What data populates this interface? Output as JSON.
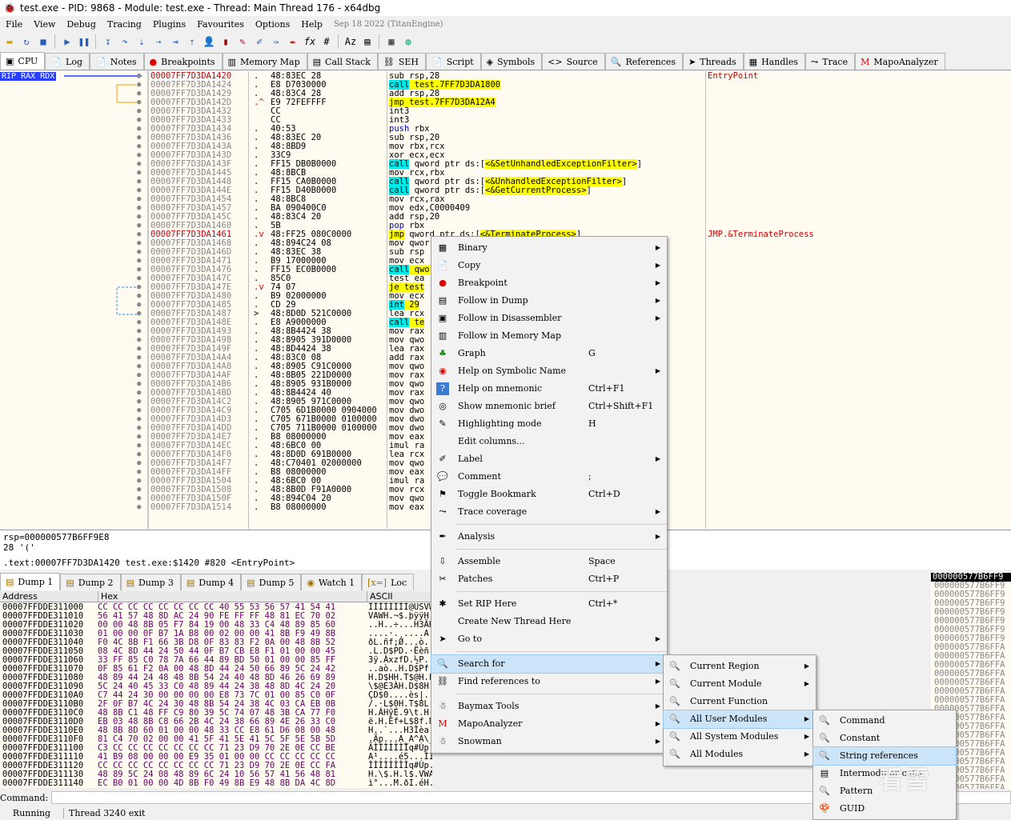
{
  "window": {
    "title": "test.exe - PID: 9868 - Module: test.exe - Thread: Main Thread 176 - x64dbg"
  },
  "menu": {
    "items": [
      "File",
      "View",
      "Debug",
      "Tracing",
      "Plugins",
      "Favourites",
      "Options",
      "Help"
    ],
    "info": "Sep 18 2022 (TitanEngine)"
  },
  "tabs": [
    "CPU",
    "Log",
    "Notes",
    "Breakpoints",
    "Memory Map",
    "Call Stack",
    "SEH",
    "Script",
    "Symbols",
    "Source",
    "References",
    "Threads",
    "Handles",
    "Trace",
    "MapoAnalyzer"
  ],
  "register_tag": "RIP RAX RDX",
  "disasm": [
    {
      "addr": "00007FF7D3DA1420",
      "m": ".",
      "bytes": "48:83EC 28",
      "instr": "sub rsp,28",
      "cmt": "EntryPoint",
      "cur": true
    },
    {
      "addr": "00007FF7D3DA1424",
      "m": ".",
      "bytes": "E8 D7030000",
      "instr": "call test.7FF7D3DA1800",
      "k": "call"
    },
    {
      "addr": "00007FF7D3DA1429",
      "m": ".",
      "bytes": "48:83C4 28",
      "instr": "add rsp,28"
    },
    {
      "addr": "00007FF7D3DA142D",
      "m": ".^",
      "bytes": "E9 72FEFFFF",
      "instr": "jmp test.7FF7D3DA12A4",
      "k": "jmp"
    },
    {
      "addr": "00007FF7D3DA1432",
      "m": "",
      "bytes": "CC",
      "instr": "int3"
    },
    {
      "addr": "00007FF7D3DA1433",
      "m": "",
      "bytes": "CC",
      "instr": "int3"
    },
    {
      "addr": "00007FF7D3DA1434",
      "m": ".",
      "bytes": "40:53",
      "instr": "push rbx"
    },
    {
      "addr": "00007FF7D3DA1436",
      "m": ".",
      "bytes": "48:83EC 20",
      "instr": "sub rsp,20"
    },
    {
      "addr": "00007FF7D3DA143A",
      "m": ".",
      "bytes": "48:8BD9",
      "instr": "mov rbx,rcx"
    },
    {
      "addr": "00007FF7D3DA143D",
      "m": ".",
      "bytes": "33C9",
      "instr": "xor ecx,ecx"
    },
    {
      "addr": "00007FF7D3DA143F",
      "m": ".",
      "bytes": "FF15 DB0B0000",
      "instr": "call qword ptr ds:[<&SetUnhandledExceptionFilter>]",
      "k": "call"
    },
    {
      "addr": "00007FF7D3DA1445",
      "m": ".",
      "bytes": "48:8BCB",
      "instr": "mov rcx,rbx"
    },
    {
      "addr": "00007FF7D3DA1448",
      "m": ".",
      "bytes": "FF15 CA0B0000",
      "instr": "call qword ptr ds:[<&UnhandledExceptionFilter>]",
      "k": "call"
    },
    {
      "addr": "00007FF7D3DA144E",
      "m": ".",
      "bytes": "FF15 D40B0000",
      "instr": "call qword ptr ds:[<&GetCurrentProcess>]",
      "k": "call"
    },
    {
      "addr": "00007FF7D3DA1454",
      "m": ".",
      "bytes": "48:8BC8",
      "instr": "mov rcx,rax"
    },
    {
      "addr": "00007FF7D3DA1457",
      "m": ".",
      "bytes": "BA 090400C0",
      "instr": "mov edx,C0000409"
    },
    {
      "addr": "00007FF7D3DA145C",
      "m": ".",
      "bytes": "48:83C4 20",
      "instr": "add rsp,20"
    },
    {
      "addr": "00007FF7D3DA1460",
      "m": ".",
      "bytes": "5B",
      "instr": "pop rbx"
    },
    {
      "addr": "00007FF7D3DA1461",
      "m": ".v",
      "bytes": "48:FF25 080C0000",
      "instr": "jmp qword ptr ds:[<&TerminateProcess>]",
      "k": "jmp",
      "cmt": "JMP.&TerminateProcess",
      "red": true
    },
    {
      "addr": "00007FF7D3DA1468",
      "m": ".",
      "bytes": "48:894C24 08",
      "instr": "mov qwor"
    },
    {
      "addr": "00007FF7D3DA146D",
      "m": ".",
      "bytes": "48:83EC 38",
      "instr": "sub rsp"
    },
    {
      "addr": "00007FF7D3DA1471",
      "m": ".",
      "bytes": "B9 17000000",
      "instr": "mov ecx"
    },
    {
      "addr": "00007FF7D3DA1476",
      "m": ".",
      "bytes": "FF15 EC0B0000",
      "instr": "call qwo",
      "k": "call"
    },
    {
      "addr": "00007FF7D3DA147C",
      "m": ".",
      "bytes": "85C0",
      "instr": "test ea"
    },
    {
      "addr": "00007FF7D3DA147E",
      "m": ".v",
      "bytes": "74 07",
      "instr": "je test",
      "k": "jmp"
    },
    {
      "addr": "00007FF7D3DA1480",
      "m": ".",
      "bytes": "B9 02000000",
      "instr": "mov ecx"
    },
    {
      "addr": "00007FF7D3DA1485",
      "m": ".",
      "bytes": "CD 29",
      "instr": "int 29",
      "k": "call"
    },
    {
      "addr": "00007FF7D3DA1487",
      "m": ">",
      "bytes": "48:8D0D 521C0000",
      "instr": "lea rcx"
    },
    {
      "addr": "00007FF7D3DA148E",
      "m": ".",
      "bytes": "E8 A9000000",
      "instr": "call te",
      "k": "call"
    },
    {
      "addr": "00007FF7D3DA1493",
      "m": ".",
      "bytes": "48:8B4424 38",
      "instr": "mov rax"
    },
    {
      "addr": "00007FF7D3DA1498",
      "m": ".",
      "bytes": "48:8905 391D0000",
      "instr": "mov qwo"
    },
    {
      "addr": "00007FF7D3DA149F",
      "m": ".",
      "bytes": "48:8D4424 38",
      "instr": "lea rax"
    },
    {
      "addr": "00007FF7D3DA14A4",
      "m": ".",
      "bytes": "48:83C0 08",
      "instr": "add rax"
    },
    {
      "addr": "00007FF7D3DA14A8",
      "m": ".",
      "bytes": "48:8905 C91C0000",
      "instr": "mov qwo"
    },
    {
      "addr": "00007FF7D3DA14AF",
      "m": ".",
      "bytes": "48:8B05 221D0000",
      "instr": "mov rax"
    },
    {
      "addr": "00007FF7D3DA14B6",
      "m": ".",
      "bytes": "48:8905 931B0000",
      "instr": "mov qwo"
    },
    {
      "addr": "00007FF7D3DA14BD",
      "m": ".",
      "bytes": "48:8B4424 40",
      "instr": "mov rax"
    },
    {
      "addr": "00007FF7D3DA14C2",
      "m": ".",
      "bytes": "48:8905 971C0000",
      "instr": "mov qwo"
    },
    {
      "addr": "00007FF7D3DA14C9",
      "m": ".",
      "bytes": "C705 6D1B0000 0904000",
      "instr": "mov dwo"
    },
    {
      "addr": "00007FF7D3DA14D3",
      "m": ".",
      "bytes": "C705 671B0000 0100000",
      "instr": "mov dwo"
    },
    {
      "addr": "00007FF7D3DA14DD",
      "m": ".",
      "bytes": "C705 711B0000 0100000",
      "instr": "mov dwo"
    },
    {
      "addr": "00007FF7D3DA14E7",
      "m": ".",
      "bytes": "B8 08000000",
      "instr": "mov eax"
    },
    {
      "addr": "00007FF7D3DA14EC",
      "m": ".",
      "bytes": "48:6BC0 00",
      "instr": "imul ra"
    },
    {
      "addr": "00007FF7D3DA14F0",
      "m": ".",
      "bytes": "48:8D0D 691B0000",
      "instr": "lea rcx"
    },
    {
      "addr": "00007FF7D3DA14F7",
      "m": ".",
      "bytes": "48:C70401 02000000",
      "instr": "mov qwo"
    },
    {
      "addr": "00007FF7D3DA14FF",
      "m": ".",
      "bytes": "B8 08000000",
      "instr": "mov eax"
    },
    {
      "addr": "00007FF7D3DA1504",
      "m": ".",
      "bytes": "48:6BC0 00",
      "instr": "imul ra"
    },
    {
      "addr": "00007FF7D3DA1508",
      "m": ".",
      "bytes": "48:8B0D F91A0000",
      "instr": "mov rcx"
    },
    {
      "addr": "00007FF7D3DA150F",
      "m": ".",
      "bytes": "48:894C04 20",
      "instr": "mov qwo"
    },
    {
      "addr": "00007FF7D3DA1514",
      "m": ".",
      "bytes": "B8 08000000",
      "instr": "mov eax"
    }
  ],
  "info": {
    "line1": "rsp=000000577B6FF9E8",
    "line2": "28 '('",
    "line3": ".text:00007FF7D3DA1420 test.exe:$1420 #820 <EntryPoint>"
  },
  "dump_tabs": [
    "Dump 1",
    "Dump 2",
    "Dump 3",
    "Dump 4",
    "Dump 5",
    "Watch 1",
    "Loc"
  ],
  "dump_header": {
    "address": "Address",
    "hex": "Hex",
    "ascii": "ASCII"
  },
  "dump": [
    {
      "a": "00007FFDDE311000",
      "h": "CC CC CC CC CC CC CC CC 40 55 53 56 57 41 54 41",
      "x": "ÌÌÌÌÌÌÌÌ@USVWATA"
    },
    {
      "a": "00007FFDDE311010",
      "h": "56 41 57 48 8D AC 24 90 FE FF FF 48 81 EC 70 02",
      "x": "VAWH.¬$.þÿÿH.ìp."
    },
    {
      "a": "00007FFDDE311020",
      "h": "00 00 48 8B 05 F7 84 19 00 48 33 C4 48 89 85 60",
      "x": "..H..÷...H3ÄH..`"
    },
    {
      "a": "00007FFDDE311030",
      "h": "01 00 00 0F B7 1A B8 00 02 00 00 41 8B F9 49 8B",
      "x": "....·.¸....A.ùI."
    },
    {
      "a": "00007FFDDE311040",
      "h": "F0 4C 8B F1 66 3B D8 0F 83 83 F2 0A 00 48 8B 52",
      "x": "ðL.ñf;Ø...ò..H.R"
    },
    {
      "a": "00007FFDDE311050",
      "h": "08 4C 8D 44 24 50 44 0F B7 CB E8 F1 01 00 00 45",
      "x": ".L.D$PD.·Ëèñ...E"
    },
    {
      "a": "00007FFDDE311060",
      "h": "33 FF 85 C0 78 7A 66 44 89 BD 50 01 00 00 85 FF",
      "x": "3ÿ.ÀxzfD.½P....ÿ"
    },
    {
      "a": "00007FFDDE311070",
      "h": "0F 85 61 F2 0A 00 48 8D 44 24 50 66 89 5C 24 42",
      "x": "..aò..H.D$Pf.\\$B"
    },
    {
      "a": "00007FFDDE311080",
      "h": "48 89 44 24 48 48 8B 54 24 40 48 8D 46 26 69 89",
      "x": "H.D$HH.T$@H.F&i."
    },
    {
      "a": "00007FFDDE311090",
      "h": "5C 24 40 45 33 C0 48 89 44 24 38 48 8D 4C 24 20",
      "x": "\\$@E3ÀH.D$8H.L$ "
    },
    {
      "a": "00007FFDDE3110A0",
      "h": "C7 44 24 30 00 00 00 00 E8 73 7C 01 00 85 C0 0F",
      "x": "ÇD$0....ès|...À."
    },
    {
      "a": "00007FFDDE3110B0",
      "h": "2F 0F B7 4C 24 30 48 8B 54 24 38 4C 03 CA EB 0B",
      "x": "/.·L$0H.T$8L.Êë."
    },
    {
      "a": "00007FFDDE3110C0",
      "h": "48 8B C1 48 FF C9 80 39 5C 74 07 48 3B CA 77 F0",
      "x": "H.ÁHÿÉ.9\\t.H;Êwð"
    },
    {
      "a": "00007FFDDE3110D0",
      "h": "EB 03 48 8B C8 66 2B 4C 24 38 66 89 4E 26 33 C0",
      "x": "ë.H.Èf+L$8f.N&3À"
    },
    {
      "a": "00007FFDDE3110E0",
      "h": "48 8B 8D 60 01 00 00 48 33 CC E8 61 D6 08 00 48",
      "x": "H..`...H3Ìèa Ö..H"
    },
    {
      "a": "00007FFDDE3110F0",
      "h": "81 C4 70 02 00 00 41 5F 41 5E 41 5C 5F 5E 5B 5D",
      "x": ".Äp...A_A^A\\_^[]"
    },
    {
      "a": "00007FFDDE311100",
      "h": "C3 CC CC CC CC CC CC CC 71 23 D9 70 2E 0E CC BE",
      "x": "ÃÌÌÌÌÌÌÌq#Ùp..Ì¾"
    },
    {
      "a": "00007FFDDE311110",
      "h": "41 B9 08 00 00 00 E9 35 01 00 00 CC CC CC CC CC",
      "x": "A¹....é5...ÌÌÌÌÌ"
    },
    {
      "a": "00007FFDDE311120",
      "h": "CC CC CC CC CC CC CC CC 71 23 D9 70 2E 0E CC FA",
      "x": "ÌÌÌÌÌÌÌÌq#Ùp..Ìú"
    },
    {
      "a": "00007FFDDE311130",
      "h": "48 89 5C 24 08 48 89 6C 24 10 56 57 41 56 48 81",
      "x": "H.\\$.H.l$.VWAVH."
    },
    {
      "a": "00007FFDDE311140",
      "h": "EC B0 01 00 00 4D 8B F0 49 8B E9 48 8B DA 4C 8D",
      "x": "ì°...M.ðI.éH.ÚL."
    }
  ],
  "stack": {
    "head": "000000577B6FF9",
    "rows": [
      "000000577B6FF9",
      "000000577B6FF9",
      "000000577B6FF9",
      "000000577B6FF9",
      "000000577B6FF9",
      "000000577B6FF9",
      "000000577B6FF9",
      "000000577B6FFA",
      "000000577B6FFA",
      "000000577B6FFA",
      "000000577B6FFA",
      "000000577B6FFA",
      "000000577B6FFA",
      "000000577B6FFA",
      "000000577B6FFA",
      "000000577B6FFA",
      "000000577B6FFA",
      "000000577B6FFA",
      "000000577B6FFA",
      "000000577B6FFA",
      "000000577B6FFA",
      "000000577B6FFA",
      "000000577B6FFA",
      "000000577B6FFA"
    ]
  },
  "command": {
    "label": "Command:",
    "value": ""
  },
  "status": {
    "state": "Running",
    "thread": "Thread  3240  exit"
  },
  "context_menu": [
    {
      "label": "Binary",
      "shortcut": "",
      "sub": true,
      "icon": "binary-icon",
      "glyph": "▦"
    },
    {
      "label": "Copy",
      "shortcut": "",
      "sub": true,
      "icon": "copy-icon",
      "glyph": "📄"
    },
    {
      "label": "Breakpoint",
      "shortcut": "",
      "sub": true,
      "icon": "breakpoint-icon",
      "glyph": "●"
    },
    {
      "label": "Follow in Dump",
      "shortcut": "",
      "sub": true,
      "icon": "dump-icon",
      "glyph": "▤"
    },
    {
      "label": "Follow in Disassembler",
      "shortcut": "",
      "sub": true,
      "icon": "cpu-icon",
      "glyph": "▣"
    },
    {
      "label": "Follow in Memory Map",
      "shortcut": "",
      "sub": false,
      "icon": "memory-map-icon",
      "glyph": "▥"
    },
    {
      "label": "Graph",
      "shortcut": "G",
      "sub": false,
      "icon": "graph-icon",
      "glyph": "♣"
    },
    {
      "label": "Help on Symbolic Name",
      "shortcut": "",
      "sub": true,
      "icon": "help-icon",
      "glyph": "◉"
    },
    {
      "label": "Help on mnemonic",
      "shortcut": "Ctrl+F1",
      "sub": false,
      "icon": "question-icon",
      "glyph": "?"
    },
    {
      "label": "Show mnemonic brief",
      "shortcut": "Ctrl+Shift+F1",
      "sub": false,
      "icon": "brief-icon",
      "glyph": "◎"
    },
    {
      "label": "Highlighting mode",
      "shortcut": "H",
      "sub": false,
      "icon": "highlight-icon",
      "glyph": "✎"
    },
    {
      "label": "Edit columns...",
      "shortcut": "",
      "sub": false,
      "icon": "",
      "glyph": ""
    },
    {
      "label": "Label",
      "shortcut": "",
      "sub": true,
      "icon": "label-icon",
      "glyph": "✐"
    },
    {
      "label": "Comment",
      "shortcut": ";",
      "sub": false,
      "icon": "comment-icon",
      "glyph": "💬"
    },
    {
      "label": "Toggle Bookmark",
      "shortcut": "Ctrl+D",
      "sub": false,
      "icon": "bookmark-icon",
      "glyph": "⚑"
    },
    {
      "label": "Trace coverage",
      "shortcut": "",
      "sub": true,
      "icon": "trace-icon",
      "glyph": "⤳"
    },
    {
      "sep": true
    },
    {
      "label": "Analysis",
      "shortcut": "",
      "sub": true,
      "icon": "analysis-icon",
      "glyph": "✒"
    },
    {
      "sep": true
    },
    {
      "label": "Assemble",
      "shortcut": "Space",
      "sub": false,
      "icon": "assemble-icon",
      "glyph": "⇩"
    },
    {
      "label": "Patches",
      "shortcut": "Ctrl+P",
      "sub": false,
      "icon": "patch-icon",
      "glyph": "✂"
    },
    {
      "sep": true
    },
    {
      "label": "Set RIP Here",
      "shortcut": "Ctrl+*",
      "sub": false,
      "icon": "rip-icon",
      "glyph": "✱"
    },
    {
      "label": "Create New Thread Here",
      "shortcut": "",
      "sub": false,
      "icon": "",
      "glyph": ""
    },
    {
      "label": "Go to",
      "shortcut": "",
      "sub": true,
      "icon": "goto-icon",
      "glyph": "➤"
    },
    {
      "sep": true
    },
    {
      "label": "Search for",
      "shortcut": "",
      "sub": true,
      "icon": "search-icon",
      "glyph": "🔍",
      "sel": true
    },
    {
      "label": "Find references to",
      "shortcut": "",
      "sub": true,
      "icon": "find-refs-icon",
      "glyph": "⛓"
    },
    {
      "sep": true
    },
    {
      "label": "Baymax Tools",
      "shortcut": "",
      "sub": true,
      "icon": "baymax-icon",
      "glyph": "☃"
    },
    {
      "label": "MapoAnalyzer",
      "shortcut": "",
      "sub": true,
      "icon": "mapo-icon",
      "glyph": "M"
    },
    {
      "label": "Snowman",
      "shortcut": "",
      "sub": true,
      "icon": "snowman-icon",
      "glyph": "☃"
    }
  ],
  "search_menu": [
    {
      "label": "Current Region",
      "sub": true,
      "sel": false
    },
    {
      "label": "Current Module",
      "sub": true,
      "sel": false
    },
    {
      "label": "Current Function",
      "sub": false,
      "sel": false
    },
    {
      "label": "All User Modules",
      "sub": true,
      "sel": true
    },
    {
      "label": "All System Modules",
      "sub": true,
      "sel": false
    },
    {
      "label": "All Modules",
      "sub": true,
      "sel": false
    }
  ],
  "user_modules_menu": [
    {
      "label": "Command",
      "sel": false,
      "icon": "command-icon"
    },
    {
      "label": "Constant",
      "sel": false,
      "icon": "constant-icon"
    },
    {
      "label": "String references",
      "sel": true,
      "icon": "string-refs-icon"
    },
    {
      "label": "Intermodular calls",
      "sel": false,
      "icon": "intermodular-icon"
    },
    {
      "label": "Pattern",
      "sel": false,
      "icon": "pattern-icon"
    },
    {
      "label": "GUID",
      "sel": false,
      "icon": "guid-icon"
    }
  ],
  "watermark": "看雪"
}
